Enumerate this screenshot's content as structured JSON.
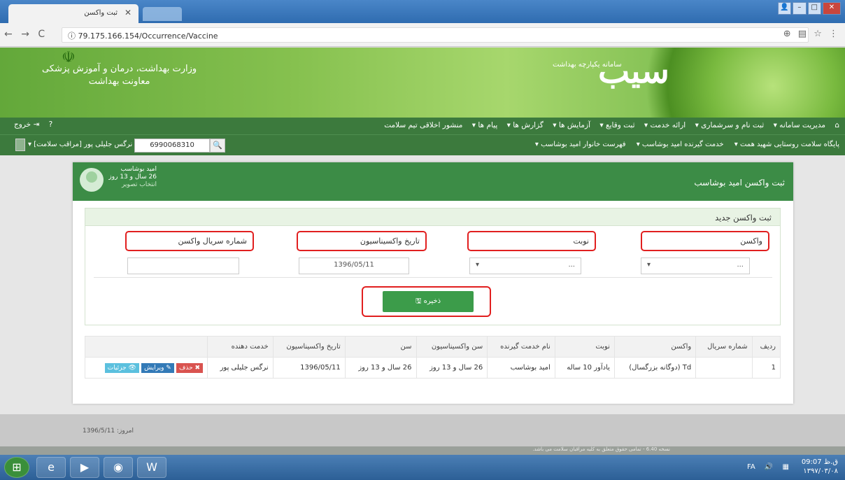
{
  "browser": {
    "tab_title": "ثبت واکسن",
    "url": "79.175.166.154/Occurrence/Vaccine"
  },
  "banner": {
    "ministry": "وزارت بهداشت، درمان و آموزش پزشکی",
    "deputy": "معاونت بهداشت",
    "brand": "سیب",
    "brand_sub": "سامانه یکپارچه بهداشت"
  },
  "menu": {
    "items": [
      "مدیریت سامانه ▾",
      "ثبت نام و سرشماری ▾",
      "ارائه خدمت ▾",
      "ثبت وقایع ▾",
      "آزمایش ها ▾",
      "گزارش ها ▾",
      "پیام ها ▾",
      "منشور اخلاقی تیم سلامت"
    ],
    "logout": "خروج"
  },
  "submenu": {
    "items": [
      "پایگاه سلامت روستایی شهید همت ▾",
      "خدمت گیرنده امید بوشاسب ▾",
      "فهرست خانوار امید بوشاسب ▾"
    ],
    "national_id": "6990068310",
    "user": "نرگس جلیلی پور [مراقب سلامت] ▾"
  },
  "page": {
    "title": "ثبت واکسن امید بوشاسب",
    "patient_name": "امید بوشاسب",
    "patient_age": "26 سال و 13 روز",
    "patient_pic": "انتخاب تصویر"
  },
  "form": {
    "heading": "ثبت واکسن جدید",
    "vaccine_label": "واکسن",
    "vaccine_value": "...",
    "turn_label": "نوبت",
    "turn_value": "...",
    "date_label": "تاریخ واکسیناسیون",
    "date_value": "1396/05/11",
    "serial_label": "شماره سریال واکسن",
    "serial_value": "",
    "save": "ذخیره"
  },
  "table": {
    "headers": [
      "ردیف",
      "شماره سریال",
      "واکسن",
      "نوبت",
      "نام خدمت گیرنده",
      "سن واکسیناسیون",
      "سن",
      "تاریخ واکسیناسیون",
      "خدمت دهنده",
      ""
    ],
    "rows": [
      {
        "row": "1",
        "serial": "",
        "vaccine": "Td (دوگانه بزرگسال)",
        "turn": "یادآور 10 ساله",
        "patient": "امید بوشاسب",
        "vacc_age": "26 سال و 13 روز",
        "age": "26 سال و 13 روز",
        "date": "1396/05/11",
        "provider": "نرگس جلیلی پور",
        "del": "حذف",
        "edit": "ویرایش",
        "details": "جزئیات"
      }
    ]
  },
  "footer": {
    "today": "امروز: 1396/5/11",
    "version": "نسخه 6.40 - تمامی حقوق متعلق به کلیه مراقبان سلامت می باشد."
  },
  "taskbar": {
    "lang": "FA",
    "time": "09:07 ق.ظ",
    "date": "۱۳۹۷/۰۳/۰۸"
  }
}
